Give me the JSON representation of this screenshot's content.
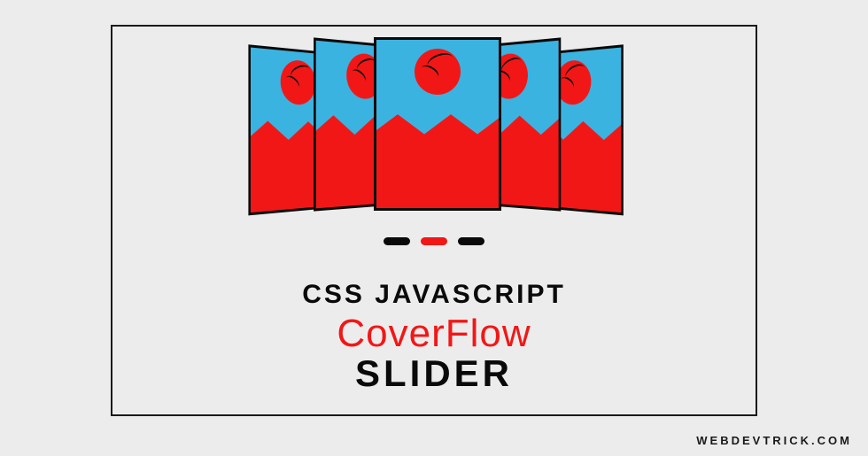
{
  "title": {
    "line1": "CSS JAVASCRIPT",
    "line2": "CoverFlow",
    "line3": "SLIDER"
  },
  "watermark": "WEBDEVTRICK.COM",
  "dots": {
    "count": 3,
    "active_index": 1
  },
  "colors": {
    "accent": "#f21717",
    "sky": "#3bb3e0",
    "frame": "#1a1a1a"
  }
}
